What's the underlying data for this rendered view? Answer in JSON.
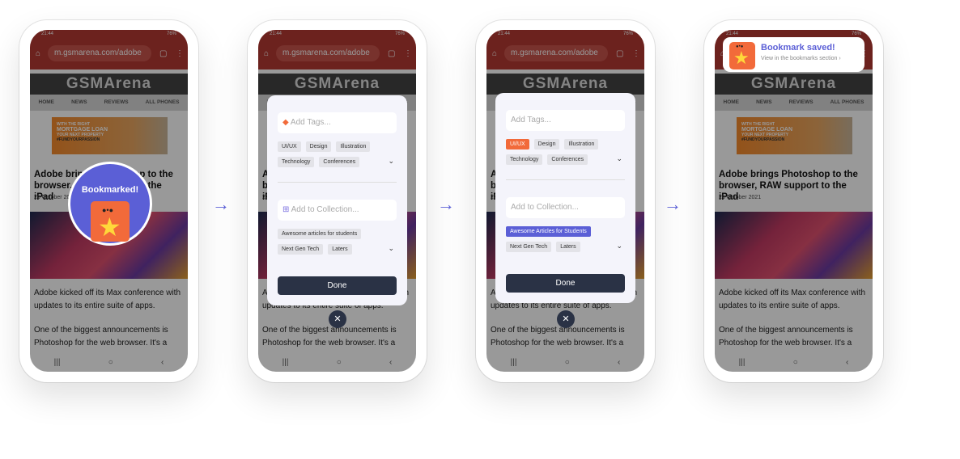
{
  "browser": {
    "time": "21:44",
    "battery": "76%",
    "url": "m.gsmarena.com/adobe"
  },
  "site": {
    "logo": "GSMArena",
    "nav": [
      "HOME",
      "NEWS",
      "REVIEWS",
      "ALL PHONES"
    ],
    "ad": [
      "WITH THE RIGHT",
      "MORTGAGE LOAN",
      "YOUR NEXT PROPERTY",
      "#FUNDYOURPASSION"
    ],
    "headline": "Adobe brings Photoshop to the browser, RAW support to the iPad",
    "date": "26 October 2021",
    "para1": "Adobe kicked off its Max conference with updates to its entire suite of apps.",
    "para2": "One of the biggest announcements is Photoshop for the web browser. It's a"
  },
  "bookmarked": {
    "label": "Bookmarked!"
  },
  "modal1": {
    "tags_placeholder": "Add Tags...",
    "tags": [
      "UI/UX",
      "Design",
      "Illustration",
      "Technology",
      "Conferences"
    ],
    "collection_placeholder": "Add to Collection...",
    "collections": [
      "Awesome articles for students",
      "Next Gen Tech",
      "Laters"
    ],
    "done": "Done"
  },
  "modal2": {
    "tags_placeholder": "Add Tags...",
    "tags": [
      "UI/UX",
      "Design",
      "Illustration",
      "Technology",
      "Conferences"
    ],
    "collection_placeholder": "Add to Collection...",
    "collections": [
      "Awesome Articles for Students",
      "Next Gen Tech",
      "Laters"
    ],
    "done": "Done",
    "selected_tag": "UI/UX",
    "selected_collection": "Awesome Articles for Students"
  },
  "toast": {
    "title": "Bookmark saved!",
    "subtitle": "View in the bookmarks section ›"
  },
  "colors": {
    "accent": "#5b5fd6",
    "tag_selected": "#f26a3a",
    "done": "#2a3245",
    "browser": "#b53a33"
  }
}
